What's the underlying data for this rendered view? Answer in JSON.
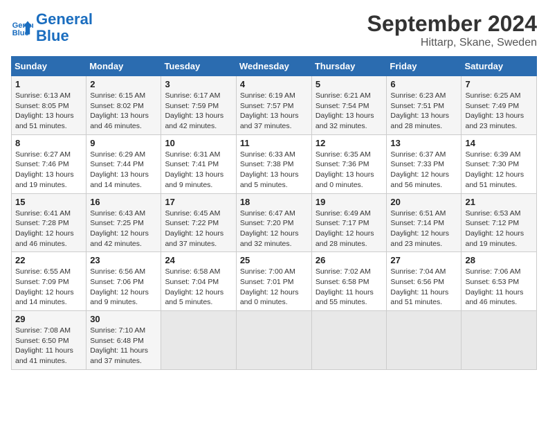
{
  "header": {
    "logo_line1": "General",
    "logo_line2": "Blue",
    "month": "September 2024",
    "location": "Hittarp, Skane, Sweden"
  },
  "weekdays": [
    "Sunday",
    "Monday",
    "Tuesday",
    "Wednesday",
    "Thursday",
    "Friday",
    "Saturday"
  ],
  "weeks": [
    [
      {
        "day": "1",
        "info": "Sunrise: 6:13 AM\nSunset: 8:05 PM\nDaylight: 13 hours\nand 51 minutes."
      },
      {
        "day": "2",
        "info": "Sunrise: 6:15 AM\nSunset: 8:02 PM\nDaylight: 13 hours\nand 46 minutes."
      },
      {
        "day": "3",
        "info": "Sunrise: 6:17 AM\nSunset: 7:59 PM\nDaylight: 13 hours\nand 42 minutes."
      },
      {
        "day": "4",
        "info": "Sunrise: 6:19 AM\nSunset: 7:57 PM\nDaylight: 13 hours\nand 37 minutes."
      },
      {
        "day": "5",
        "info": "Sunrise: 6:21 AM\nSunset: 7:54 PM\nDaylight: 13 hours\nand 32 minutes."
      },
      {
        "day": "6",
        "info": "Sunrise: 6:23 AM\nSunset: 7:51 PM\nDaylight: 13 hours\nand 28 minutes."
      },
      {
        "day": "7",
        "info": "Sunrise: 6:25 AM\nSunset: 7:49 PM\nDaylight: 13 hours\nand 23 minutes."
      }
    ],
    [
      {
        "day": "8",
        "info": "Sunrise: 6:27 AM\nSunset: 7:46 PM\nDaylight: 13 hours\nand 19 minutes."
      },
      {
        "day": "9",
        "info": "Sunrise: 6:29 AM\nSunset: 7:44 PM\nDaylight: 13 hours\nand 14 minutes."
      },
      {
        "day": "10",
        "info": "Sunrise: 6:31 AM\nSunset: 7:41 PM\nDaylight: 13 hours\nand 9 minutes."
      },
      {
        "day": "11",
        "info": "Sunrise: 6:33 AM\nSunset: 7:38 PM\nDaylight: 13 hours\nand 5 minutes."
      },
      {
        "day": "12",
        "info": "Sunrise: 6:35 AM\nSunset: 7:36 PM\nDaylight: 13 hours\nand 0 minutes."
      },
      {
        "day": "13",
        "info": "Sunrise: 6:37 AM\nSunset: 7:33 PM\nDaylight: 12 hours\nand 56 minutes."
      },
      {
        "day": "14",
        "info": "Sunrise: 6:39 AM\nSunset: 7:30 PM\nDaylight: 12 hours\nand 51 minutes."
      }
    ],
    [
      {
        "day": "15",
        "info": "Sunrise: 6:41 AM\nSunset: 7:28 PM\nDaylight: 12 hours\nand 46 minutes."
      },
      {
        "day": "16",
        "info": "Sunrise: 6:43 AM\nSunset: 7:25 PM\nDaylight: 12 hours\nand 42 minutes."
      },
      {
        "day": "17",
        "info": "Sunrise: 6:45 AM\nSunset: 7:22 PM\nDaylight: 12 hours\nand 37 minutes."
      },
      {
        "day": "18",
        "info": "Sunrise: 6:47 AM\nSunset: 7:20 PM\nDaylight: 12 hours\nand 32 minutes."
      },
      {
        "day": "19",
        "info": "Sunrise: 6:49 AM\nSunset: 7:17 PM\nDaylight: 12 hours\nand 28 minutes."
      },
      {
        "day": "20",
        "info": "Sunrise: 6:51 AM\nSunset: 7:14 PM\nDaylight: 12 hours\nand 23 minutes."
      },
      {
        "day": "21",
        "info": "Sunrise: 6:53 AM\nSunset: 7:12 PM\nDaylight: 12 hours\nand 19 minutes."
      }
    ],
    [
      {
        "day": "22",
        "info": "Sunrise: 6:55 AM\nSunset: 7:09 PM\nDaylight: 12 hours\nand 14 minutes."
      },
      {
        "day": "23",
        "info": "Sunrise: 6:56 AM\nSunset: 7:06 PM\nDaylight: 12 hours\nand 9 minutes."
      },
      {
        "day": "24",
        "info": "Sunrise: 6:58 AM\nSunset: 7:04 PM\nDaylight: 12 hours\nand 5 minutes."
      },
      {
        "day": "25",
        "info": "Sunrise: 7:00 AM\nSunset: 7:01 PM\nDaylight: 12 hours\nand 0 minutes."
      },
      {
        "day": "26",
        "info": "Sunrise: 7:02 AM\nSunset: 6:58 PM\nDaylight: 11 hours\nand 55 minutes."
      },
      {
        "day": "27",
        "info": "Sunrise: 7:04 AM\nSunset: 6:56 PM\nDaylight: 11 hours\nand 51 minutes."
      },
      {
        "day": "28",
        "info": "Sunrise: 7:06 AM\nSunset: 6:53 PM\nDaylight: 11 hours\nand 46 minutes."
      }
    ],
    [
      {
        "day": "29",
        "info": "Sunrise: 7:08 AM\nSunset: 6:50 PM\nDaylight: 11 hours\nand 41 minutes."
      },
      {
        "day": "30",
        "info": "Sunrise: 7:10 AM\nSunset: 6:48 PM\nDaylight: 11 hours\nand 37 minutes."
      },
      {
        "day": "",
        "info": ""
      },
      {
        "day": "",
        "info": ""
      },
      {
        "day": "",
        "info": ""
      },
      {
        "day": "",
        "info": ""
      },
      {
        "day": "",
        "info": ""
      }
    ]
  ]
}
